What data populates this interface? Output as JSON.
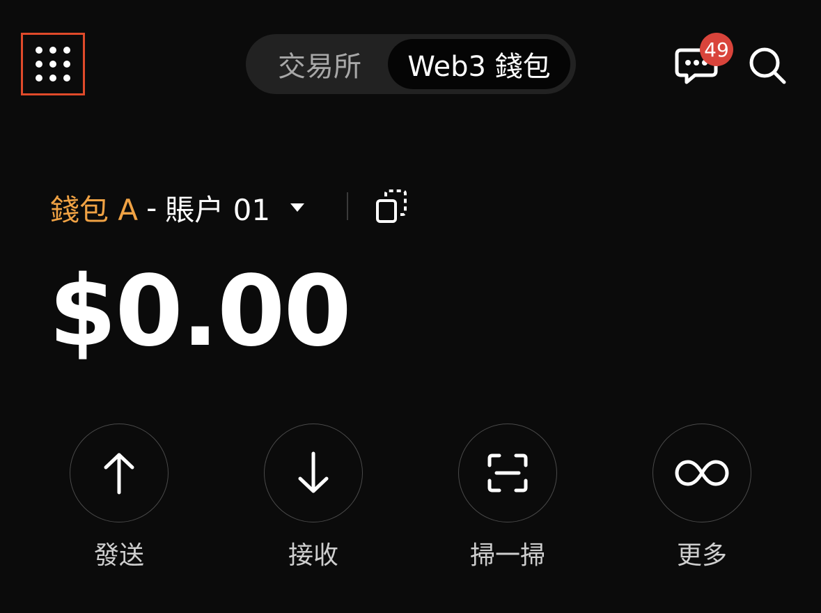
{
  "header": {
    "tabs": [
      {
        "label": "交易所",
        "active": false
      },
      {
        "label": "Web3 錢包",
        "active": true
      }
    ],
    "notification_count": "49",
    "menu_icon": "grid-dots-icon",
    "chat_icon": "chat-bubble-icon",
    "search_icon": "search-icon"
  },
  "account": {
    "wallet_name": "錢包 A",
    "separator": "-",
    "account_name": "賬户 01",
    "wallet_color": "#f0a244"
  },
  "balance": {
    "value": "$0.00"
  },
  "actions": [
    {
      "label": "發送",
      "icon": "arrow-up-icon"
    },
    {
      "label": "接收",
      "icon": "arrow-down-icon"
    },
    {
      "label": "掃一掃",
      "icon": "scan-icon"
    },
    {
      "label": "更多",
      "icon": "infinity-icon"
    }
  ],
  "colors": {
    "background": "#0b0b0b",
    "accent": "#f0a244",
    "badge": "#d9443b",
    "highlight_border": "#e04a2a"
  }
}
